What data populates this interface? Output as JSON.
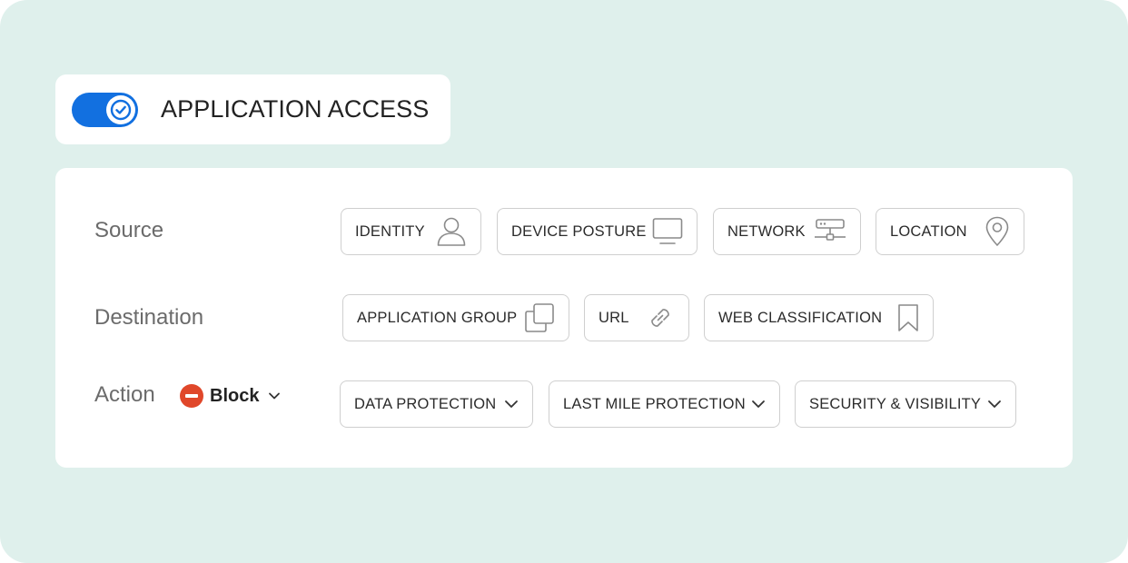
{
  "header": {
    "title": "APPLICATION ACCESS",
    "toggle_on": true
  },
  "rows": {
    "source": {
      "label": "Source",
      "chips": [
        {
          "label": "IDENTITY",
          "icon": "user-icon"
        },
        {
          "label": "DEVICE POSTURE",
          "icon": "monitor-icon"
        },
        {
          "label": "NETWORK",
          "icon": "server-network-icon"
        },
        {
          "label": "LOCATION",
          "icon": "map-pin-icon"
        }
      ]
    },
    "destination": {
      "label": "Destination",
      "chips": [
        {
          "label": "APPLICATION GROUP",
          "icon": "stacked-squares-icon"
        },
        {
          "label": "URL",
          "icon": "link-icon"
        },
        {
          "label": "WEB CLASSIFICATION",
          "icon": "bookmark-icon"
        }
      ]
    },
    "action": {
      "label": "Action",
      "selected": "Block",
      "dropdowns": [
        {
          "label": "DATA PROTECTION",
          "icon": "chevron-down-icon"
        },
        {
          "label": "LAST MILE PROTECTION",
          "icon": "chevron-down-icon"
        },
        {
          "label": "SECURITY & VISIBILITY",
          "icon": "chevron-down-icon"
        }
      ]
    }
  },
  "colors": {
    "background": "#dff0ec",
    "toggle": "#1270e0",
    "block": "#e0472a",
    "chip_border": "#cfcfcf",
    "icon": "#8a8a8a"
  }
}
